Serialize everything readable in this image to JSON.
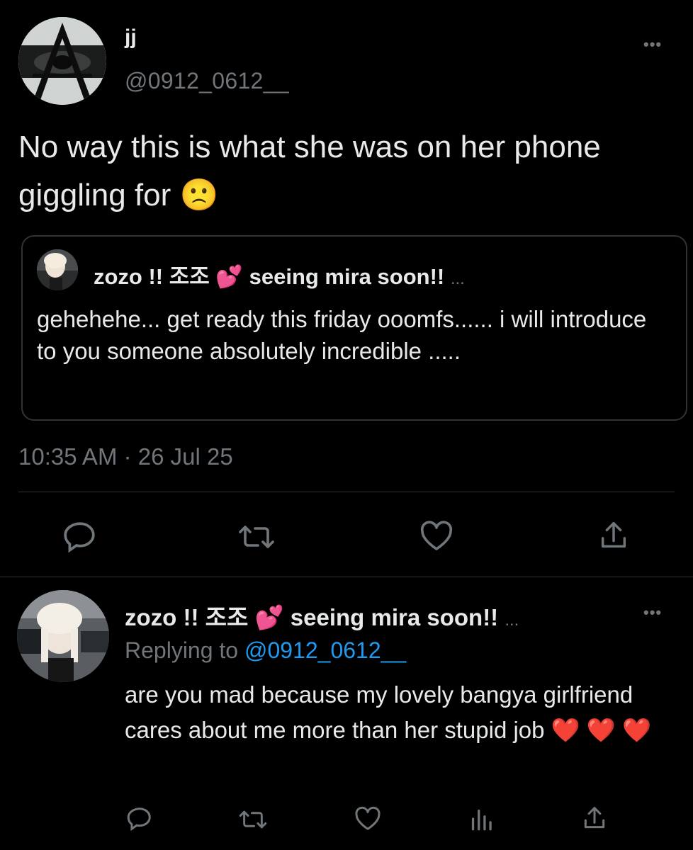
{
  "main_tweet": {
    "display_name": "jj",
    "handle": "@0912_0612__",
    "text": "No way this is what she was on her phone giggling for 🙁",
    "more_icon": "more-horizontal-icon",
    "timestamp": "10:35 AM · 26 Jul 25"
  },
  "quoted_tweet": {
    "display_name": "zozo !! 조조 💕 seeing mira soon!!",
    "ellipsis": "...",
    "text": "gehehehe... get ready this friday ooomfs...... i will introduce to you someone absolutely incredible ....."
  },
  "main_actions": [
    "reply-icon",
    "retweet-icon",
    "like-icon",
    "share-icon"
  ],
  "reply_tweet": {
    "display_name": "zozo !! 조조 💕 seeing mira soon!!",
    "ellipsis": "...",
    "replying_prefix": "Replying to",
    "replying_to": "@0912_0612__",
    "text": "are you mad because my lovely bangya girlfriend cares about me more than her stupid job ❤️ ❤️ ❤️",
    "actions": [
      "reply-icon",
      "retweet-icon",
      "like-icon",
      "analytics-icon",
      "share-icon"
    ]
  },
  "colors": {
    "background": "#000000",
    "text": "#e7e9ea",
    "secondary": "#71767b",
    "link": "#1d9bf0",
    "border": "#2f3336"
  }
}
